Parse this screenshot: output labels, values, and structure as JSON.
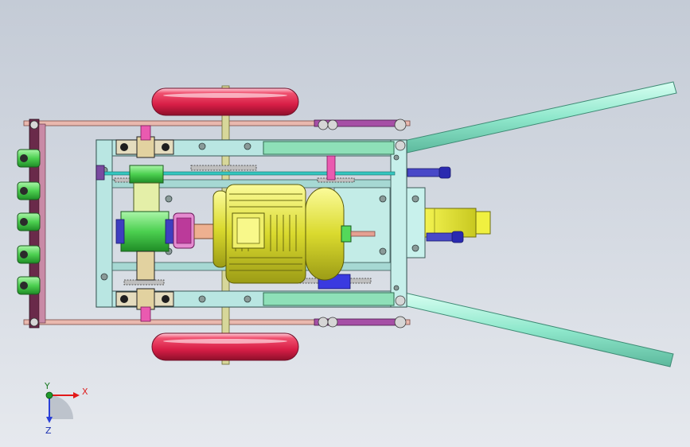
{
  "triad": {
    "x_label": "X",
    "y_label": "Y",
    "z_label": "Z",
    "x_color": "#e21a1a",
    "y_color": "#1f9a2a",
    "z_color": "#2a3fd8"
  },
  "palette": {
    "frame": "#b6e3df",
    "frame_stroke": "#4b6a68",
    "handle": "#9ff0d6",
    "wheel": "#e8264f",
    "motor": "#dede3a",
    "gearbox": "#54d85a",
    "bearing": "#2b2b2b",
    "link_bar": "#e8b0a8",
    "link_purple": "#8a3a8a",
    "shaft_pink": "#e85aa8",
    "coupling": "#e7a08a",
    "blue_part": "#3a3ac8",
    "teal_bar": "#3ad0c8"
  }
}
